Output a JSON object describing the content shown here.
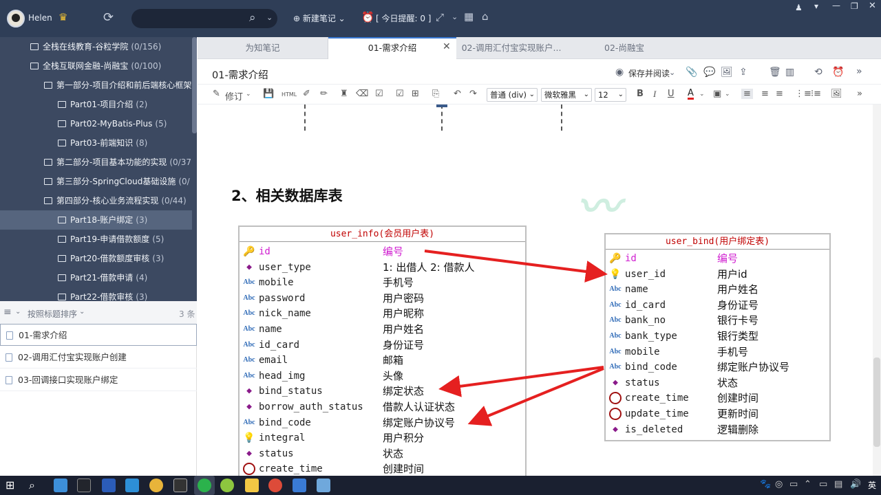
{
  "topbar": {
    "username": "Helen",
    "new_note": "⊕ 新建笔记 ⌄",
    "reminder": "[ 今日提醒: 0 ]"
  },
  "tree": [
    {
      "label": "全栈在线教育-谷粒学院",
      "count": "(0/156)"
    },
    {
      "label": "全栈互联网金融-尚融宝",
      "count": "(0/100)"
    },
    {
      "label": "第一部分-项目介绍和前后端核心框架",
      "count": ""
    },
    {
      "label": "Part01-项目介绍",
      "count": "(2)"
    },
    {
      "label": "Part02-MyBatis-Plus",
      "count": "(5)"
    },
    {
      "label": "Part03-前端知识",
      "count": "(8)"
    },
    {
      "label": "第二部分-项目基本功能的实现",
      "count": "(0/37"
    },
    {
      "label": "第三部分-SpringCloud基础设施",
      "count": "(0/"
    },
    {
      "label": "第四部分-核心业务流程实现",
      "count": "(0/44)"
    },
    {
      "label": "Part18-账户绑定",
      "count": "(3)"
    },
    {
      "label": "Part19-申请借款额度",
      "count": "(5)"
    },
    {
      "label": "Part20-借款额度审核",
      "count": "(3)"
    },
    {
      "label": "Part21-借款申请",
      "count": "(4)"
    },
    {
      "label": "Part22-借款审核",
      "count": "(3)"
    }
  ],
  "list": {
    "sort_label": "按照标题排序",
    "count": "3 条",
    "items": [
      "01-需求介绍",
      "02-调用汇付宝实现账户创建",
      "03-回调接口实现账户绑定"
    ]
  },
  "tabs": [
    "为知笔记",
    "01-需求介绍",
    "02-调用汇付宝实现账户...",
    "02-尚融宝"
  ],
  "note": {
    "title": "01-需求介绍",
    "save_label": "保存并阅读"
  },
  "toolbar": {
    "revise": "修订",
    "html": "HTML",
    "format": "普通 (div)",
    "font": "微软雅黑",
    "size": "12"
  },
  "doc": {
    "heading": "2、相关数据库表",
    "user_info": {
      "header": "user_info(会员用户表)",
      "rows": [
        {
          "icon": "key",
          "field": "id",
          "cn": "编号",
          "pk": true
        },
        {
          "icon": "dia",
          "field": "user_type",
          "cn": "1: 出借人 2: 借款人"
        },
        {
          "icon": "abc",
          "field": "mobile",
          "cn": "手机号"
        },
        {
          "icon": "abc",
          "field": "password",
          "cn": "用户密码"
        },
        {
          "icon": "abc",
          "field": "nick_name",
          "cn": "用户昵称"
        },
        {
          "icon": "abc",
          "field": "name",
          "cn": "用户姓名"
        },
        {
          "icon": "abc",
          "field": "id_card",
          "cn": "身份证号"
        },
        {
          "icon": "abc",
          "field": "email",
          "cn": "邮箱"
        },
        {
          "icon": "abc",
          "field": "head_img",
          "cn": "头像"
        },
        {
          "icon": "dia",
          "field": "bind_status",
          "cn": "绑定状态"
        },
        {
          "icon": "dia",
          "field": "borrow_auth_status",
          "cn": "借款人认证状态"
        },
        {
          "icon": "abc",
          "field": "bind_code",
          "cn": "绑定账户协议号"
        },
        {
          "icon": "bulb",
          "field": "integral",
          "cn": "用户积分"
        },
        {
          "icon": "dia",
          "field": "status",
          "cn": "状态"
        },
        {
          "icon": "clock",
          "field": "create_time",
          "cn": "创建时间"
        }
      ]
    },
    "user_bind": {
      "header": "user_bind(用户绑定表)",
      "rows": [
        {
          "icon": "key",
          "field": "id",
          "cn": "编号",
          "pk": true
        },
        {
          "icon": "bulb",
          "field": "user_id",
          "cn": "用户id"
        },
        {
          "icon": "abc",
          "field": "name",
          "cn": "用户姓名"
        },
        {
          "icon": "abc",
          "field": "id_card",
          "cn": "身份证号"
        },
        {
          "icon": "abc",
          "field": "bank_no",
          "cn": "银行卡号"
        },
        {
          "icon": "abc",
          "field": "bank_type",
          "cn": "银行类型"
        },
        {
          "icon": "abc",
          "field": "mobile",
          "cn": "手机号"
        },
        {
          "icon": "abc",
          "field": "bind_code",
          "cn": "绑定账户协议号"
        },
        {
          "icon": "dia",
          "field": "status",
          "cn": "状态"
        },
        {
          "icon": "clock",
          "field": "create_time",
          "cn": "创建时间"
        },
        {
          "icon": "clock",
          "field": "update_time",
          "cn": "更新时间"
        },
        {
          "icon": "dia",
          "field": "is_deleted",
          "cn": "逻辑删除"
        }
      ]
    }
  },
  "taskbar": {
    "ime": "英"
  }
}
